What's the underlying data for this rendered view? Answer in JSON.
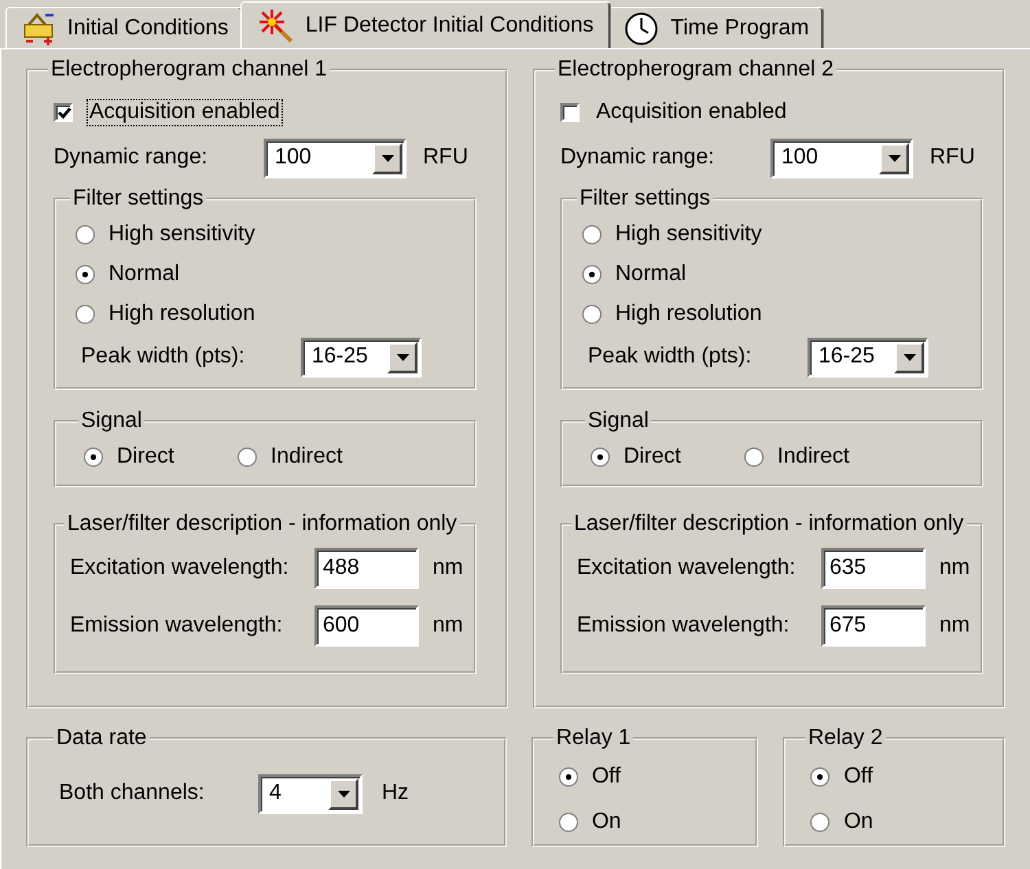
{
  "tabs": [
    {
      "label": "Initial Conditions",
      "selected": false
    },
    {
      "label": "LIF Detector Initial Conditions",
      "selected": true
    },
    {
      "label": "Time Program",
      "selected": false
    }
  ],
  "channels": [
    {
      "title": "Electropherogram channel 1",
      "acquisition": {
        "label": "Acquisition enabled",
        "checked": true,
        "focused": true
      },
      "dynamic_range": {
        "label": "Dynamic range:",
        "value": "100",
        "unit": "RFU"
      },
      "filter": {
        "title": "Filter settings",
        "options": [
          {
            "label": "High sensitivity",
            "selected": false
          },
          {
            "label": "Normal",
            "selected": true
          },
          {
            "label": "High resolution",
            "selected": false
          }
        ],
        "peak_width": {
          "label": "Peak width (pts):",
          "value": "16-25"
        }
      },
      "signal": {
        "title": "Signal",
        "options": [
          {
            "label": "Direct",
            "selected": true
          },
          {
            "label": "Indirect",
            "selected": false
          }
        ]
      },
      "laser": {
        "title": "Laser/filter description - information only",
        "fields": [
          {
            "label": "Excitation wavelength:",
            "value": "488",
            "unit": "nm"
          },
          {
            "label": "Emission wavelength:",
            "value": "600",
            "unit": "nm"
          }
        ]
      }
    },
    {
      "title": "Electropherogram channel 2",
      "acquisition": {
        "label": "Acquisition enabled",
        "checked": false,
        "focused": false
      },
      "dynamic_range": {
        "label": "Dynamic range:",
        "value": "100",
        "unit": "RFU"
      },
      "filter": {
        "title": "Filter settings",
        "options": [
          {
            "label": "High sensitivity",
            "selected": false
          },
          {
            "label": "Normal",
            "selected": true
          },
          {
            "label": "High resolution",
            "selected": false
          }
        ],
        "peak_width": {
          "label": "Peak width (pts):",
          "value": "16-25"
        }
      },
      "signal": {
        "title": "Signal",
        "options": [
          {
            "label": "Direct",
            "selected": true
          },
          {
            "label": "Indirect",
            "selected": false
          }
        ]
      },
      "laser": {
        "title": "Laser/filter description - information only",
        "fields": [
          {
            "label": "Excitation wavelength:",
            "value": "635",
            "unit": "nm"
          },
          {
            "label": "Emission wavelength:",
            "value": "675",
            "unit": "nm"
          }
        ]
      }
    }
  ],
  "data_rate": {
    "title": "Data rate",
    "label": "Both channels:",
    "value": "4",
    "unit": "Hz"
  },
  "relays": [
    {
      "title": "Relay 1",
      "options": [
        {
          "label": "Off",
          "selected": true
        },
        {
          "label": "On",
          "selected": false
        }
      ]
    },
    {
      "title": "Relay 2",
      "options": [
        {
          "label": "Off",
          "selected": true
        },
        {
          "label": "On",
          "selected": false
        }
      ]
    }
  ]
}
